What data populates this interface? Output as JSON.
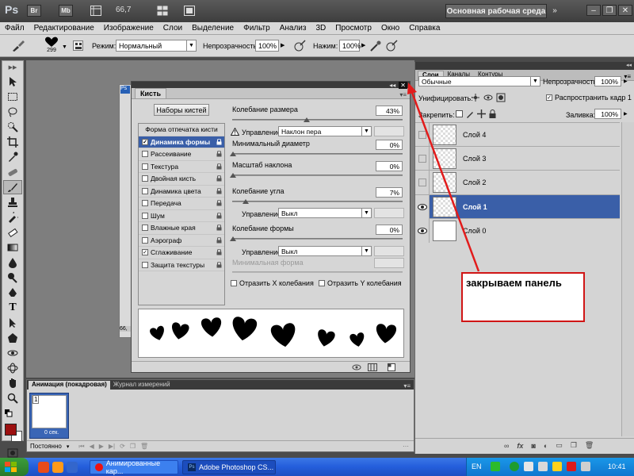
{
  "appbar": {
    "logo": "Ps",
    "br_button": "Br",
    "mb_button": "Mb",
    "zoom": "66,7",
    "workspace_button": "Основная рабочая среда"
  },
  "menu": [
    "Файл",
    "Редактирование",
    "Изображение",
    "Слои",
    "Выделение",
    "Фильтр",
    "Анализ",
    "3D",
    "Просмотр",
    "Окно",
    "Справка"
  ],
  "options": {
    "brush_size": "299",
    "mode_label": "Режим:",
    "mode_value": "Нормальный",
    "opacity_label": "Непрозрачность:",
    "opacity_value": "100%",
    "pressure_label": "Нажим:",
    "pressure_value": "100%"
  },
  "brush_panel": {
    "tab_brush": "Кисть",
    "presets_button": "Наборы кистей",
    "tip_shape": "Форма отпечатка кисти",
    "items": [
      {
        "label": "Динамика формы",
        "checked": true,
        "selected": true
      },
      {
        "label": "Рассеивание",
        "checked": false,
        "selected": false
      },
      {
        "label": "Текстура",
        "checked": false,
        "selected": false
      },
      {
        "label": "Двойная кисть",
        "checked": false,
        "selected": false
      },
      {
        "label": "Динамика цвета",
        "checked": false,
        "selected": false
      },
      {
        "label": "Передача",
        "checked": false,
        "selected": false
      },
      {
        "label": "Шум",
        "checked": false,
        "selected": false
      },
      {
        "label": "Влажные края",
        "checked": false,
        "selected": false
      },
      {
        "label": "Аэрограф",
        "checked": false,
        "selected": false
      },
      {
        "label": "Сглаживание",
        "checked": true,
        "selected": false
      },
      {
        "label": "Защита текстуры",
        "checked": false,
        "selected": false
      }
    ],
    "size_jitter_label": "Колебание размера",
    "size_jitter_value": "43%",
    "control_label": "Управление:",
    "control_value": "Наклон пера",
    "min_diameter_label": "Минимальный диаметр",
    "min_diameter_value": "0%",
    "tilt_scale_label": "Масштаб наклона",
    "tilt_scale_value": "0%",
    "angle_jitter_label": "Колебание угла",
    "angle_jitter_value": "7%",
    "angle_control_label": "Управление:",
    "angle_control_value": "Выкл",
    "roundness_jitter_label": "Колебание формы",
    "roundness_jitter_value": "0%",
    "roundness_control_label": "Управление:",
    "roundness_control_value": "Выкл",
    "min_roundness_label": "Минимальная форма",
    "flip_x": "Отразить X колебания",
    "flip_y": "Отразить Y колебания"
  },
  "canvas": {
    "zoom_left": "66,"
  },
  "animation": {
    "tab_animation": "Анимация (покадровая)",
    "tab_measurements": "Журнал измерений",
    "frame_number": "1",
    "frame_time": "0 сек.",
    "loop": "Постоянно"
  },
  "layers": {
    "tab_layers": "Слои",
    "tab_channels": "Каналы",
    "tab_paths": "Контуры",
    "blend_mode": "Обычные",
    "opacity_label": "Непрозрачность:",
    "opacity_value": "100%",
    "unify_label": "Унифицировать:",
    "propagate_label": "Распространить кадр 1",
    "lock_label": "Закрепить:",
    "fill_label": "Заливка:",
    "fill_value": "100%",
    "items": [
      {
        "name": "Слой 4",
        "visible": false,
        "selected": false
      },
      {
        "name": "Слой 3",
        "visible": false,
        "selected": false
      },
      {
        "name": "Слой 2",
        "visible": false,
        "selected": false
      },
      {
        "name": "Слой 1",
        "visible": true,
        "selected": true
      },
      {
        "name": "Слой 0",
        "visible": true,
        "selected": false
      }
    ]
  },
  "callout": "закрываем панель",
  "taskbar": {
    "task1": "Анимированные кар...",
    "task2": "Adobe Photoshop CS...",
    "lang": "EN",
    "clock": "10:41"
  },
  "colors": {
    "accent_selected": "#3a5fa8",
    "callout_border": "#d01515",
    "foreground_swatch": "#9c1010"
  }
}
